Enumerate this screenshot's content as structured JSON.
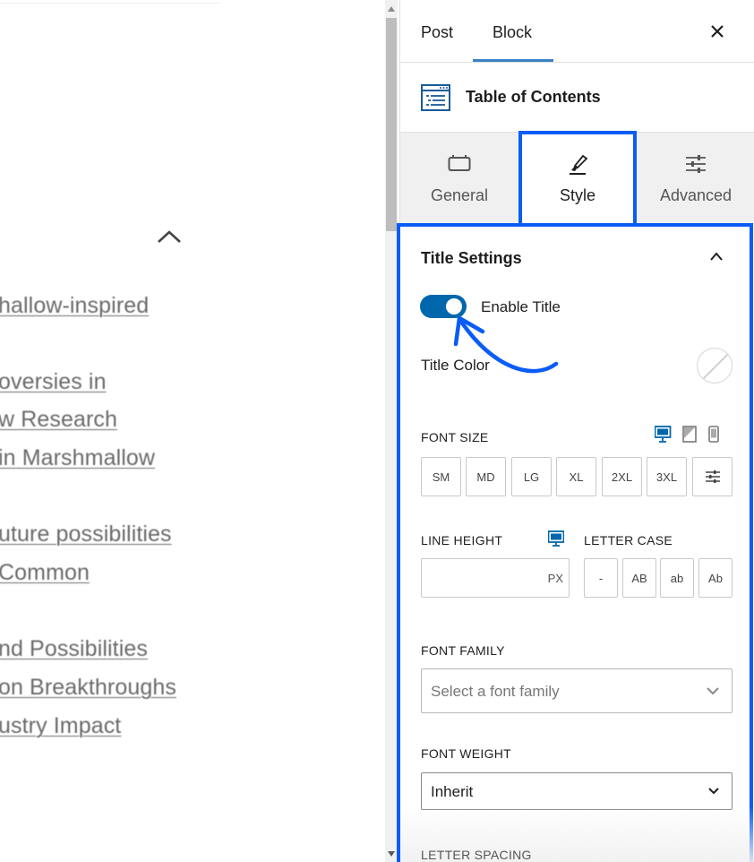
{
  "editor": {
    "toc_links": [
      "hallow-inspired",
      "oversies in",
      "w Research",
      " in Marshmallow",
      "uture possibilities",
      "Common",
      "nd Possibilities",
      "on Breakthroughs",
      "ustry Impact"
    ]
  },
  "sidebar": {
    "tabs": {
      "post": "Post",
      "block": "Block",
      "active": "Block"
    },
    "block_title": "Table of Contents",
    "subtabs": {
      "general": "General",
      "style": "Style",
      "advanced": "Advanced",
      "active": "Style"
    },
    "panel": {
      "title": "Title Settings",
      "enable_title": {
        "label": "Enable Title",
        "on": true
      },
      "title_color": {
        "label": "Title Color",
        "value": "none"
      },
      "font_size": {
        "label": "FONT SIZE",
        "options": [
          "SM",
          "MD",
          "LG",
          "XL",
          "2XL",
          "3XL"
        ]
      },
      "line_height": {
        "label": "LINE HEIGHT",
        "value": "",
        "unit": "PX"
      },
      "letter_case": {
        "label": "LETTER CASE",
        "options": [
          "-",
          "AB",
          "ab",
          "Ab"
        ]
      },
      "font_family": {
        "label": "FONT FAMILY",
        "placeholder": "Select a font family"
      },
      "font_weight": {
        "label": "FONT WEIGHT",
        "value": "Inherit"
      },
      "letter_spacing": {
        "label": "LETTER SPACING"
      }
    }
  },
  "colors": {
    "highlight": "#0a5cf5",
    "toggle_on": "#0067ac",
    "tab_underline": "#3b82c4",
    "device_active": "#0067ac"
  },
  "icons": {
    "close": "close-icon",
    "block": "table-of-contents-icon",
    "general": "general-tab-icon",
    "style": "brush-icon",
    "advanced": "sliders-icon",
    "collapse": "chevron-up-icon"
  }
}
